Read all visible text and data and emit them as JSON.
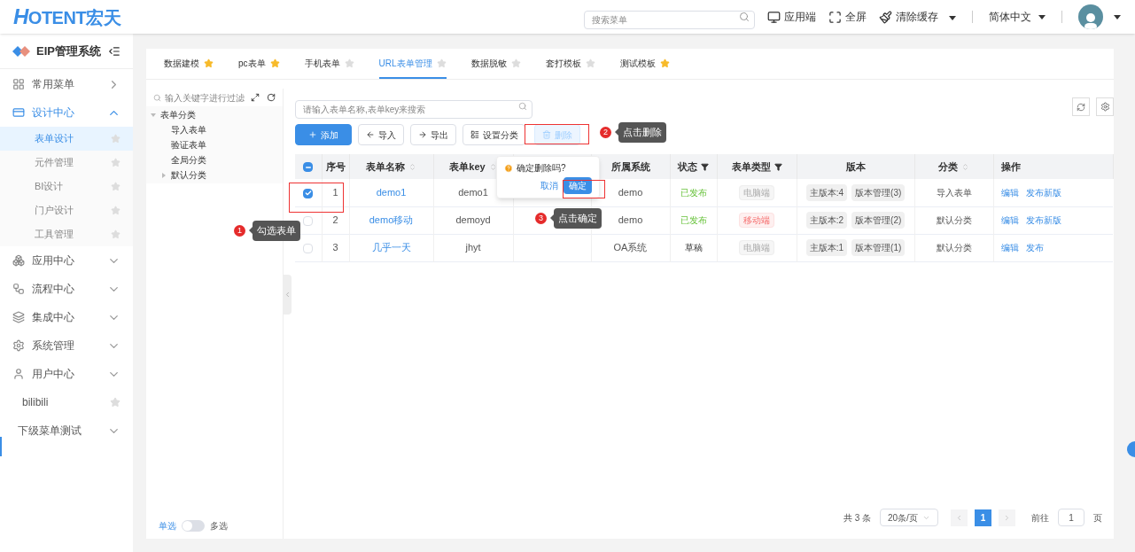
{
  "header": {
    "logo": "HOTENT宏天",
    "search_placeholder": "搜索菜单",
    "actions": [
      {
        "kind": "app",
        "label": "应用端",
        "dropdown": false
      },
      {
        "kind": "fullscreen",
        "label": "全屏",
        "dropdown": false
      },
      {
        "kind": "clear",
        "label": "清除缓存",
        "dropdown": true
      }
    ],
    "language": "简体中文"
  },
  "sidebar": {
    "title": "EIP管理系统",
    "items": [
      {
        "kind": "flyout",
        "label": "常用菜单",
        "expanded": false
      },
      {
        "kind": "group",
        "label": "设计中心",
        "expanded": true,
        "children": [
          {
            "label": "表单设计",
            "selected": true
          },
          {
            "label": "元件管理",
            "selected": false
          },
          {
            "label": "BI设计",
            "selected": false
          },
          {
            "label": "门户设计",
            "selected": false
          },
          {
            "label": "工具管理",
            "selected": false
          }
        ]
      },
      {
        "kind": "group",
        "label": "应用中心",
        "expanded": false
      },
      {
        "kind": "group",
        "label": "流程中心",
        "expanded": false
      },
      {
        "kind": "group",
        "label": "集成中心",
        "expanded": false
      },
      {
        "kind": "group",
        "label": "系统管理",
        "expanded": false
      },
      {
        "kind": "group",
        "label": "用户中心",
        "expanded": false
      },
      {
        "kind": "link",
        "label": "bilibili"
      },
      {
        "kind": "group",
        "label": "下级菜单测试",
        "expanded": false
      }
    ]
  },
  "tabs": [
    {
      "label": "数据建模",
      "selected": false,
      "starred": true
    },
    {
      "label": "pc表单",
      "selected": false,
      "starred": true
    },
    {
      "label": "手机表单",
      "selected": false,
      "starred": false
    },
    {
      "label": "URL表单管理",
      "selected": true,
      "starred": false
    },
    {
      "label": "数据脱敏",
      "selected": false,
      "starred": false
    },
    {
      "label": "套打模板",
      "selected": false,
      "starred": false
    },
    {
      "label": "测试模板",
      "selected": false,
      "starred": true
    }
  ],
  "tree": {
    "placeholder": "输入关键字进行过滤",
    "nodes": [
      {
        "label": "表单分类",
        "expanded": true,
        "children": [
          {
            "label": "导入表单"
          },
          {
            "label": "验证表单"
          },
          {
            "label": "全局分类"
          },
          {
            "label": "默认分类",
            "expanded": false
          }
        ]
      }
    ]
  },
  "select_mode": {
    "left": "单选",
    "right": "多选",
    "on": false
  },
  "table_search_placeholder": "请输入表单名称,表单key来搜索",
  "toolbar": [
    {
      "kind": "add",
      "label": "添加"
    },
    {
      "kind": "import",
      "label": "导入"
    },
    {
      "kind": "export",
      "label": "导出"
    },
    {
      "kind": "category",
      "label": "设置分类"
    },
    {
      "kind": "delete",
      "label": "删除"
    }
  ],
  "table": {
    "header_checkbox": {
      "indeterminate": true
    },
    "columns": [
      {
        "label": "序号",
        "sort": false,
        "filter": false
      },
      {
        "label": "表单名称",
        "sort": true,
        "filter": false
      },
      {
        "label": "表单key",
        "sort": true,
        "filter": false
      },
      {
        "label": "所属系统",
        "sort": false,
        "filter": false
      },
      {
        "label": "状态",
        "sort": false,
        "filter": true
      },
      {
        "label": "表单类型",
        "sort": false,
        "filter": true
      },
      {
        "label": "版本",
        "sort": false,
        "filter": false
      },
      {
        "label": "分类",
        "sort": true,
        "filter": false
      },
      {
        "label": "操作",
        "sort": false,
        "filter": false
      }
    ],
    "rows": [
      {
        "checked": true,
        "index": "1",
        "name": "demo1",
        "key": "demo1",
        "system": "demo",
        "status": "已发布",
        "published": true,
        "type": "电脑端",
        "type_alert": false,
        "versions": [
          "主版本:4",
          "版本管理(3)"
        ],
        "category": "导入表单",
        "actions": [
          "编辑",
          "发布新版"
        ]
      },
      {
        "checked": false,
        "index": "2",
        "name": "demo移动",
        "key": "demoyd",
        "system": "demo",
        "status": "已发布",
        "published": true,
        "type": "移动端",
        "type_alert": true,
        "versions": [
          "主版本:2",
          "版本管理(2)"
        ],
        "category": "默认分类",
        "actions": [
          "编辑",
          "发布新版"
        ]
      },
      {
        "checked": false,
        "index": "3",
        "name": "几乎一天",
        "key": "jhyt",
        "system": "OA系统",
        "status": "草稿",
        "published": false,
        "type": "电脑端",
        "type_alert": false,
        "versions": [
          "主版本:1",
          "版本管理(1)"
        ],
        "category": "默认分类",
        "actions": [
          "编辑",
          "发布"
        ]
      }
    ]
  },
  "popconfirm": {
    "message": "确定删除吗?",
    "cancel": "取消",
    "confirm": "确定"
  },
  "annotations": [
    {
      "number": "1",
      "text": "勾选表单"
    },
    {
      "number": "2",
      "text": "点击删除"
    },
    {
      "number": "3",
      "text": "点击确定"
    }
  ],
  "pagination": {
    "total": "共 3 条",
    "page_size": "20条/页",
    "pages": [
      {
        "label": "1",
        "selected": true
      }
    ],
    "goto_label": "前往",
    "goto_value": "1",
    "page_suffix": "页"
  }
}
